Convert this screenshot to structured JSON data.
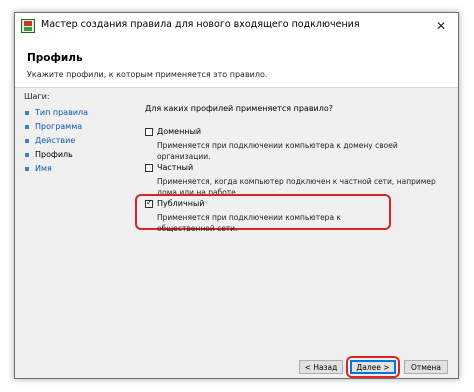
{
  "window": {
    "title": "Мастер создания правила для нового входящего подключения",
    "close_glyph": "✕"
  },
  "header": {
    "title": "Профиль",
    "subtitle": "Укажите профили, к которым применяется это правило."
  },
  "sidebar": {
    "steps_label": "Шаги:",
    "items": [
      {
        "label": "Тип правила"
      },
      {
        "label": "Программа"
      },
      {
        "label": "Действие"
      },
      {
        "label": "Профиль"
      },
      {
        "label": "Имя"
      }
    ]
  },
  "content": {
    "question": "Для каких профилей применяется правило?",
    "options": [
      {
        "label": "Доменный",
        "checked": false,
        "description": "Применяется при подключении компьютера к домену своей организации."
      },
      {
        "label": "Частный",
        "checked": false,
        "description": "Применяется, когда компьютер подключен к частной сети, например дома или на работе."
      },
      {
        "label": "Публичный",
        "checked": true,
        "description": "Применяется при подключении компьютера к общественной сети."
      }
    ]
  },
  "buttons": {
    "back": "< Назад",
    "next": "Далее >",
    "cancel": "Отмена"
  },
  "colors": {
    "highlight": "#d9252a",
    "link": "#0b57b0",
    "default_button_border": "#0078d7"
  }
}
